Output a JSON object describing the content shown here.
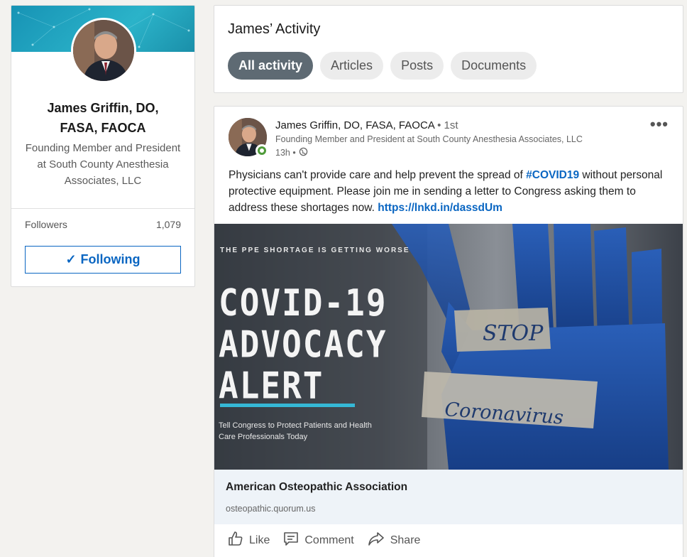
{
  "profile": {
    "name": "James Griffin, DO, FASA, FAOCA",
    "headline": "Founding Member and President at South County Anesthesia Associates, LLC",
    "followers_label": "Followers",
    "followers_count": "1,079",
    "follow_button": "Following",
    "check_glyph": "✓"
  },
  "activity": {
    "title": "James’ Activity",
    "filters": [
      {
        "label": "All activity",
        "active": true
      },
      {
        "label": "Articles",
        "active": false
      },
      {
        "label": "Posts",
        "active": false
      },
      {
        "label": "Documents",
        "active": false
      }
    ]
  },
  "post": {
    "author": "James Griffin, DO, FASA, FAOCA",
    "degree": " • 1st",
    "author_headline": "Founding Member and President at South County Anesthesia Associates, LLC",
    "time": "13h •",
    "more": "•••",
    "text_before": "Physicians can't provide care and help prevent the spread of ",
    "hashtag": "#COVID19",
    "text_after": " without personal protective equipment. Please join me in sending a letter to Congress asking them to address these shortages now. ",
    "link": "https://lnkd.in/dassdUm",
    "image": {
      "kicker": "THE PPE SHORTAGE IS GETTING WORSE",
      "headline_1": "COVID-19",
      "headline_2": "ADVOCACY",
      "headline_3": "ALERT",
      "subtext": "Tell Congress to Protect Patients and Health Care Professionals Today",
      "tape_1": "STOP",
      "tape_2": "Coronavirus"
    },
    "link_preview": {
      "title": "American Osteopathic Association",
      "url": "osteopathic.quorum.us"
    },
    "actions": {
      "like": "Like",
      "comment": "Comment",
      "share": "Share"
    }
  },
  "colors": {
    "accent": "#0a66c2",
    "page_bg": "#f3f2ef",
    "active_pill": "#5e6a73",
    "online": "#4f9b3a",
    "image_bar": "#35b8d6"
  }
}
